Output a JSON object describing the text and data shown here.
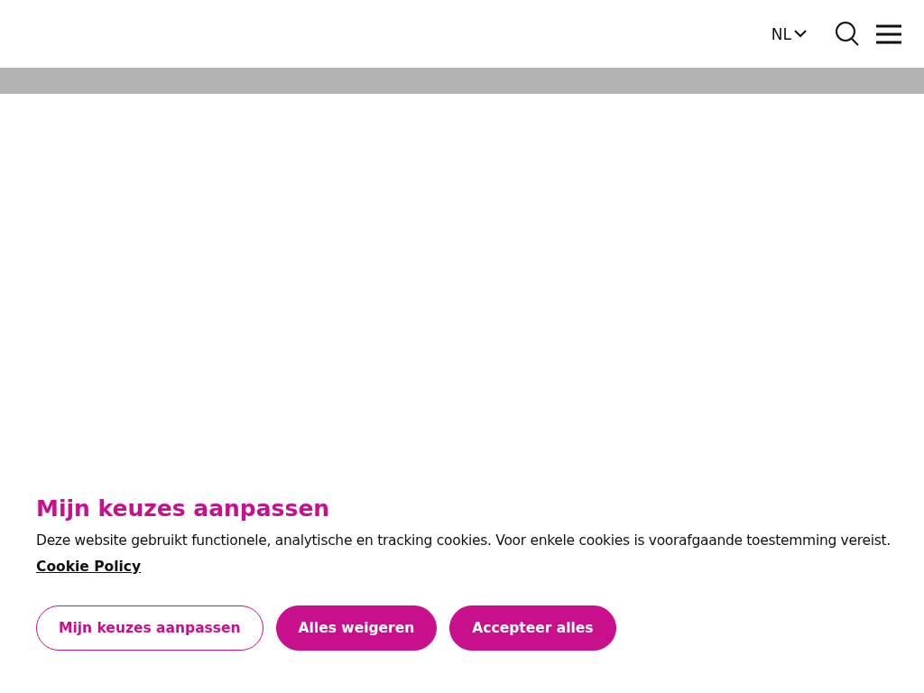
{
  "header": {
    "language": "NL"
  },
  "cookie_banner": {
    "title": "Mijn keuzes aanpassen",
    "text": "Deze website gebruikt functionele, analytische en tracking cookies. Voor enkele cookies is voorafgaande toestemming vereist.",
    "link": "Cookie Policy",
    "buttons": [
      {
        "label": "Mijn keuzes aanpassen",
        "kind": "outline"
      },
      {
        "label": "Alles weigeren",
        "kind": "filled"
      },
      {
        "label": "Accepteer alles",
        "kind": "filled"
      }
    ]
  }
}
